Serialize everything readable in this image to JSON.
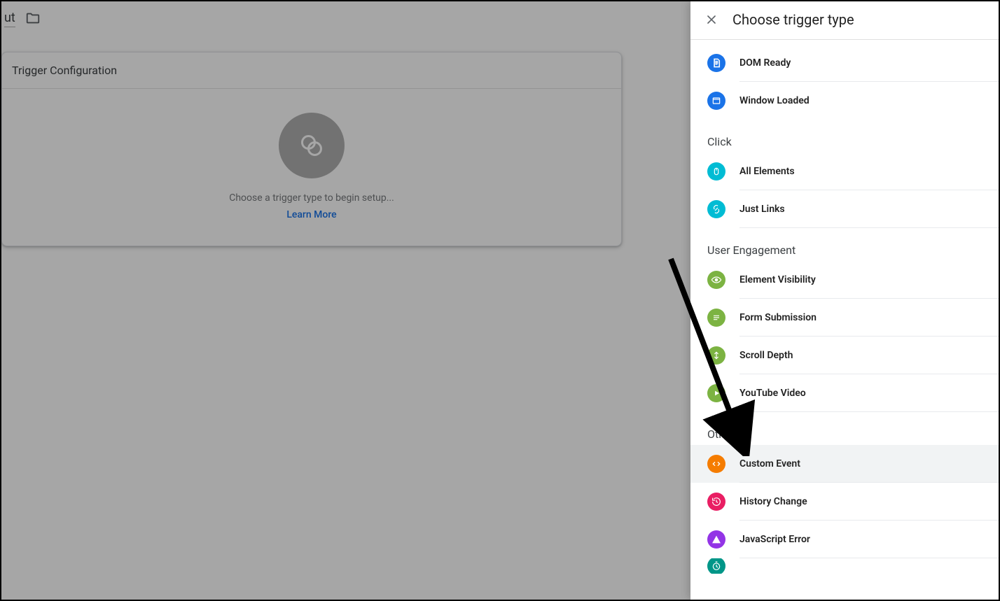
{
  "topbar": {
    "name_fragment": "ut"
  },
  "card": {
    "title": "Trigger Configuration",
    "placeholder_msg": "Choose a trigger type to begin setup...",
    "learn_more": "Learn More"
  },
  "panel": {
    "title": "Choose trigger type",
    "pageview_items": {
      "dom_ready": "DOM Ready",
      "window_loaded": "Window Loaded"
    },
    "click": {
      "label": "Click",
      "all_elements": "All Elements",
      "just_links": "Just Links"
    },
    "engagement": {
      "label": "User Engagement",
      "element_visibility": "Element Visibility",
      "form_submission": "Form Submission",
      "scroll_depth": "Scroll Depth",
      "youtube_video": "YouTube Video"
    },
    "other": {
      "label": "Other",
      "custom_event": "Custom Event",
      "history_change": "History Change",
      "javascript_error": "JavaScript Error"
    }
  }
}
